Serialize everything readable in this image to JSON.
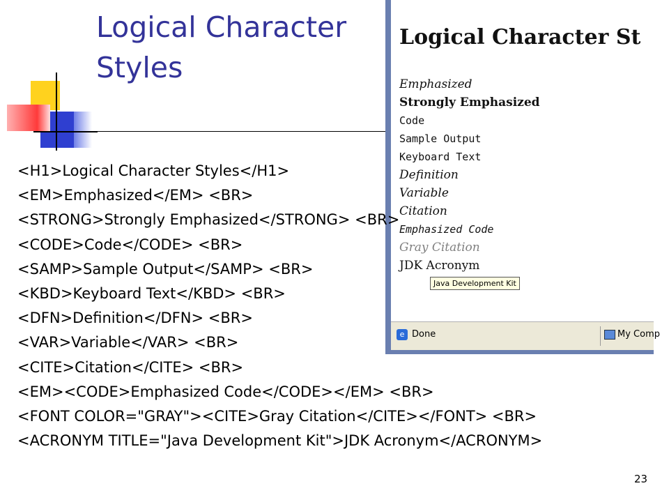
{
  "slide": {
    "title": "Logical Character Styles",
    "page_number": "23"
  },
  "code_lines": [
    "<H1>Logical Character Styles</H1>",
    "<EM>Emphasized</EM> <BR>",
    "<STRONG>Strongly Emphasized</STRONG> <BR>",
    "<CODE>Code</CODE> <BR>",
    "<SAMP>Sample Output</SAMP> <BR>",
    "<KBD>Keyboard Text</KBD> <BR>",
    "<DFN>Definition</DFN> <BR>",
    "<VAR>Variable</VAR> <BR>",
    "<CITE>Citation</CITE> <BR>",
    "<EM><CODE>Emphasized Code</CODE></EM> <BR>",
    "<FONT COLOR=\"GRAY\"><CITE>Gray Citation</CITE></FONT> <BR>",
    "<ACRONYM TITLE=\"Java Development Kit\">JDK Acronym</ACRONYM>"
  ],
  "browser_screenshot": {
    "heading": "Logical Character St",
    "lines": [
      {
        "text": "Emphasized",
        "style": "em"
      },
      {
        "text": "Strongly Emphasized",
        "style": "strong"
      },
      {
        "text": "Code",
        "style": "code"
      },
      {
        "text": "Sample Output",
        "style": "samp"
      },
      {
        "text": "Keyboard Text",
        "style": "kbd"
      },
      {
        "text": "Definition",
        "style": "dfn"
      },
      {
        "text": "Variable",
        "style": "var"
      },
      {
        "text": "Citation",
        "style": "cite"
      },
      {
        "text": "Emphasized Code",
        "style": "em-code"
      },
      {
        "text": "Gray Citation",
        "style": "gray-cite"
      },
      {
        "text": "JDK Acronym",
        "style": "acronym"
      }
    ],
    "tooltip": "Java Development Kit",
    "status_text": "Done",
    "status_zone": "My Comp"
  },
  "colors": {
    "title": "#333399",
    "gray_text": "#808080",
    "logo_yellow": "#ffd21e",
    "logo_blue": "#2f3fd0",
    "logo_red": "#ff3a3a"
  }
}
